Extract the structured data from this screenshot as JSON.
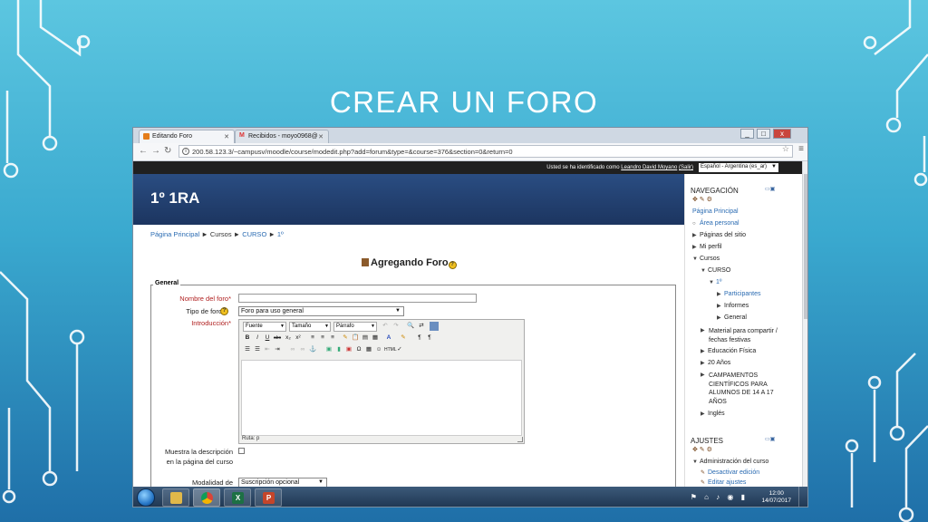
{
  "slide": {
    "title": "CREAR UN FORO"
  },
  "browser": {
    "tabs": [
      {
        "label": "Editando Foro",
        "icon": "moodle-favicon"
      },
      {
        "label": "Recibidos - moyo0968@",
        "icon": "gmail-favicon"
      }
    ],
    "window_controls": [
      "_",
      "□",
      "x"
    ],
    "url": "200.58.123.3/~campusv/moodle/course/modedit.php?add=forum&type=&course=376&section=0&return=0"
  },
  "moodle": {
    "userbar": {
      "prefix": "Usted se ha identificado como",
      "user": "Leandro David Moyano",
      "logout": "(Salir)",
      "language": "Español - Argentina (es_ar)"
    },
    "course_title": "1º 1RA",
    "breadcrumb": [
      "Página Principal",
      "Cursos",
      "CURSO",
      "1º"
    ],
    "page_heading": "Agregando Foro",
    "form": {
      "legend": "General",
      "name_label": "Nombre del foro",
      "name_value": "",
      "type_label": "Tipo de foro",
      "type_value": "Foro para uso general",
      "intro_label": "Introducción",
      "editor": {
        "font_select": "Fuente",
        "size_select": "Tamaño",
        "format_select": "Párrafo",
        "path": "Ruta: p"
      },
      "show_desc_label_1": "Muestra la descripción",
      "show_desc_label_2": "en la página del curso",
      "subscription_label": "Modalidad de",
      "subscription_value": "Suscripción opcional"
    },
    "navigation": {
      "title": "NAVEGACIÓN",
      "items": [
        {
          "label": "Página Principal",
          "link": true
        },
        {
          "label": "Área personal",
          "link": true
        },
        {
          "label": "Páginas del sitio",
          "link": false
        },
        {
          "label": "Mi perfil",
          "link": false
        },
        {
          "label": "Cursos",
          "link": false
        },
        {
          "label": "CURSO",
          "link": false
        },
        {
          "label": "1º",
          "link": true
        },
        {
          "label": "Participantes",
          "link": true
        },
        {
          "label": "Informes",
          "link": false
        },
        {
          "label": "General",
          "link": false
        },
        {
          "label": "Material para compartir / fechas festivas",
          "link": false
        },
        {
          "label": "Educación Física",
          "link": false
        },
        {
          "label": "20 Años",
          "link": false
        },
        {
          "label": "CAMPAMENTOS CIENTÍFICOS PARA ALUMNOS DE 14 A 17 AÑOS",
          "link": false
        },
        {
          "label": "Inglés",
          "link": false
        }
      ]
    },
    "settings": {
      "title": "AJUSTES",
      "items": [
        {
          "label": "Administración del curso",
          "link": false
        },
        {
          "label": "Desactivar edición",
          "link": true
        },
        {
          "label": "Editar ajustes",
          "link": true
        }
      ]
    }
  },
  "taskbar": {
    "apps": [
      "file-explorer",
      "chrome",
      "excel",
      "powerpoint"
    ],
    "time": "12:00",
    "date": "14/07/2017"
  }
}
